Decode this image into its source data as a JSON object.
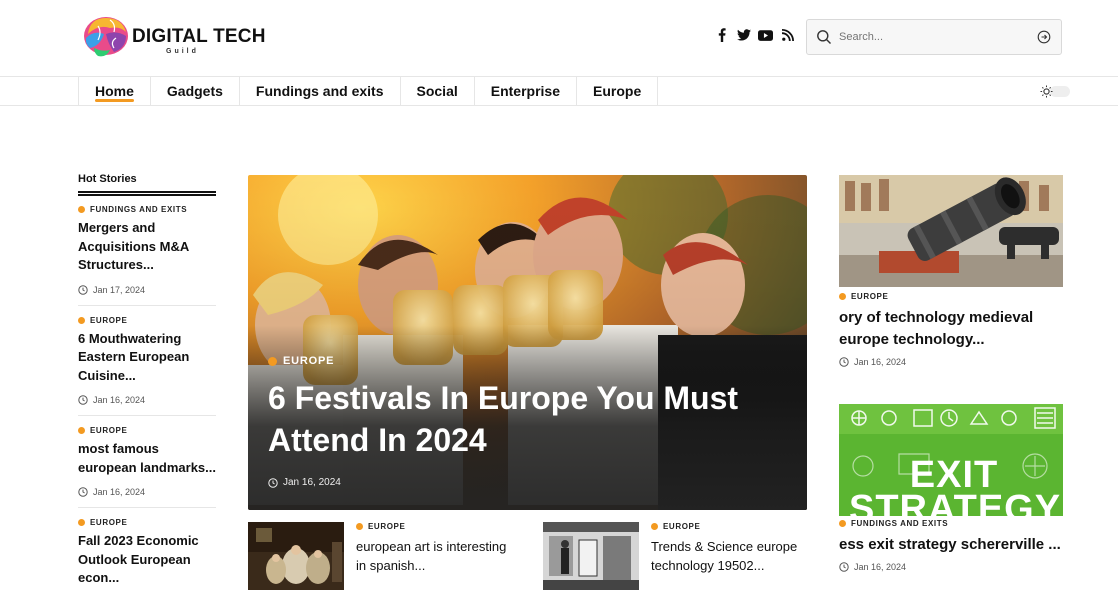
{
  "site": {
    "brand_title": "DIGITAL TECH",
    "brand_sub": "Guild"
  },
  "social_icons": [
    "facebook-icon",
    "twitter-icon",
    "youtube-icon",
    "rss-icon"
  ],
  "search": {
    "placeholder": "Search..."
  },
  "nav": {
    "items": [
      {
        "label": "Home",
        "active": true
      },
      {
        "label": "Gadgets",
        "active": false
      },
      {
        "label": "Fundings and exits",
        "active": false
      },
      {
        "label": "Social",
        "active": false
      },
      {
        "label": "Enterprise",
        "active": false
      },
      {
        "label": "Europe",
        "active": false
      }
    ]
  },
  "hot_stories": {
    "title": "Hot Stories",
    "items": [
      {
        "category": "FUNDINGS AND EXITS",
        "headline": "Mergers and Acquisitions M&A Structures...",
        "date": "Jan 17, 2024"
      },
      {
        "category": "EUROPE",
        "headline": "6 Mouthwatering Eastern European Cuisine...",
        "date": "Jan 16, 2024"
      },
      {
        "category": "EUROPE",
        "headline": "most famous european landmarks...",
        "date": "Jan 16, 2024"
      },
      {
        "category": "EUROPE",
        "headline": "Fall 2023 Economic Outlook European econ...",
        "date": ""
      }
    ]
  },
  "featured": {
    "category": "EUROPE",
    "headline": "6 Festivals In Europe You Must Attend In 2024",
    "date": "Jan 16, 2024"
  },
  "small_cards": [
    {
      "category": "EUROPE",
      "headline": "european art is interesting in spanish..."
    },
    {
      "category": "EUROPE",
      "headline": "Trends & Science europe technology 19502..."
    }
  ],
  "right_cards": [
    {
      "category": "EUROPE",
      "headline": "ory of technology medieval europe technology...",
      "date": "Jan 16, 2024"
    },
    {
      "category": "FUNDINGS AND EXITS",
      "headline": "ess exit strategy schererville ...",
      "date": "Jan 16, 2024",
      "image_text": "EXIT STRATEGY"
    }
  ],
  "colors": {
    "accent": "#f39a21",
    "exit_green": "#5bb531"
  }
}
